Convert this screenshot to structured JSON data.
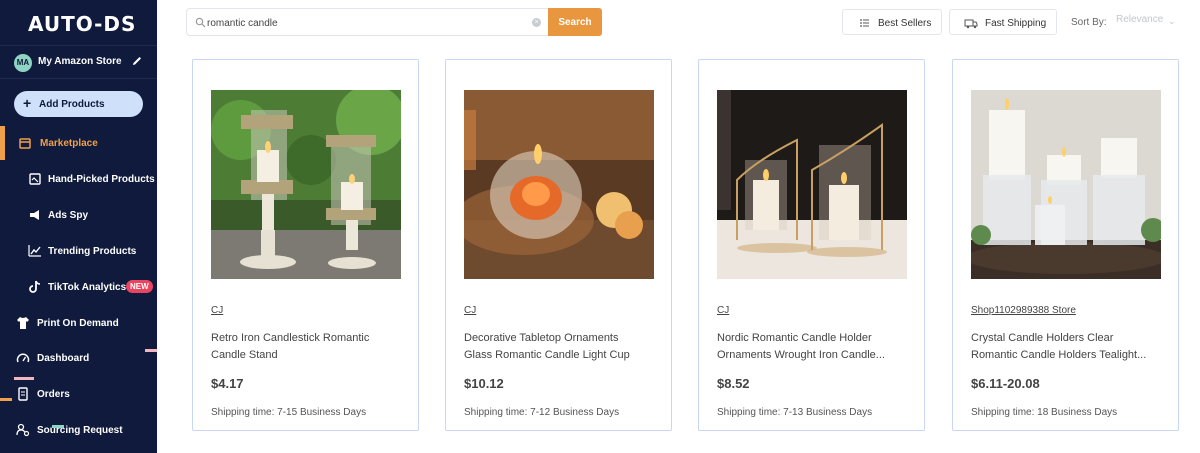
{
  "sidebar": {
    "logo": "AUTO-DS",
    "store": {
      "initials": "MA",
      "name": "My Amazon Store"
    },
    "add_products": "Add Products",
    "items": [
      {
        "label": "Marketplace",
        "icon": "store-icon"
      },
      {
        "label": "Hand-Picked Products",
        "icon": "picked-products-icon"
      },
      {
        "label": "Ads Spy",
        "icon": "megaphone-icon"
      },
      {
        "label": "Trending Products",
        "icon": "trending-chart-icon"
      },
      {
        "label": "TikTok Analytics",
        "icon": "tiktok-icon",
        "badge": "NEW"
      },
      {
        "label": "Print On Demand",
        "icon": "tshirt-icon"
      },
      {
        "label": "Dashboard",
        "icon": "gauge-icon"
      },
      {
        "label": "Orders",
        "icon": "orders-icon"
      },
      {
        "label": "Sourcing Request",
        "icon": "sourcing-icon"
      }
    ]
  },
  "topbar": {
    "search_value": "romantic candle",
    "search_button": "Search",
    "best_sellers": "Best Sellers",
    "fast_shipping": "Fast Shipping",
    "sort_label": "Sort By:",
    "sort_value": "Relevance"
  },
  "products": [
    {
      "supplier": "CJ",
      "title_line1": "Retro Iron Candlestick Romantic",
      "title_line2": "Candle Stand",
      "price": "$4.17",
      "shipping": "Shipping time: 7-15 Business Days"
    },
    {
      "supplier": "CJ",
      "title_line1": "Decorative Tabletop Ornaments",
      "title_line2": "Glass Romantic Candle Light Cup",
      "price": "$10.12",
      "shipping": "Shipping time: 7-12 Business Days"
    },
    {
      "supplier": "CJ",
      "title_line1": "Nordic Romantic Candle Holder",
      "title_line2": "Ornaments Wrought Iron Candle...",
      "price": "$8.52",
      "shipping": "Shipping time: 7-13 Business Days"
    },
    {
      "supplier": "Shop1102989388 Store",
      "title_line1": "Crystal Candle Holders Clear",
      "title_line2": "Romantic Candle Holders Tealight...",
      "price": "$6.11-20.08",
      "shipping": "Shipping time: 18 Business Days"
    }
  ],
  "colors": {
    "sidebar_bg": "#0f1a3c",
    "accent": "#e8973f",
    "card_border": "#c9d8f2",
    "badge": "#e94560"
  }
}
